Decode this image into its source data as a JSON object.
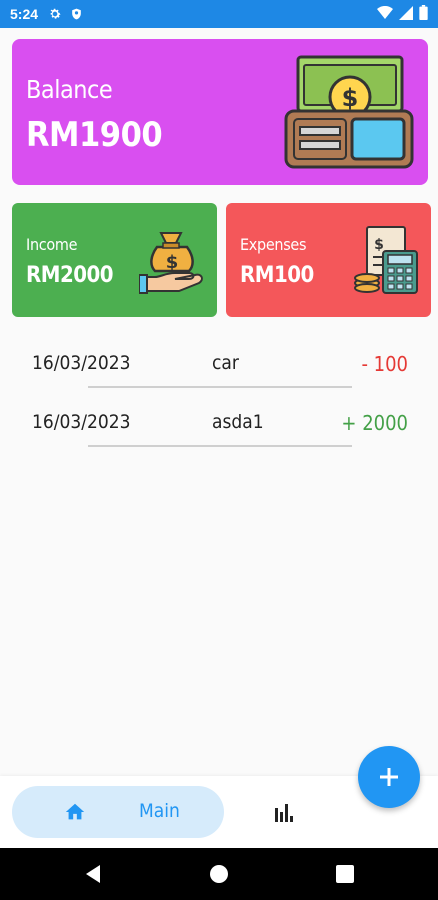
{
  "status_bar": {
    "time": "5:24"
  },
  "balance": {
    "label": "Balance",
    "amount": "RM1900"
  },
  "income": {
    "label": "Income",
    "amount": "RM2000"
  },
  "expenses": {
    "label": "Expenses",
    "amount": "RM100"
  },
  "transactions": [
    {
      "date": "16/03/2023",
      "name": "car",
      "amount": "- 100",
      "color": "#e53935"
    },
    {
      "date": "16/03/2023",
      "name": "asda1",
      "amount": "+ 2000",
      "color": "#43a047"
    }
  ],
  "bottom_nav": {
    "main_label": "Main"
  },
  "fab": {
    "icon": "plus-icon"
  },
  "colors": {
    "accent": "#2196f3",
    "balance_card": "#d94ff0",
    "income_card": "#4caf50",
    "expense_card": "#f4575a"
  }
}
